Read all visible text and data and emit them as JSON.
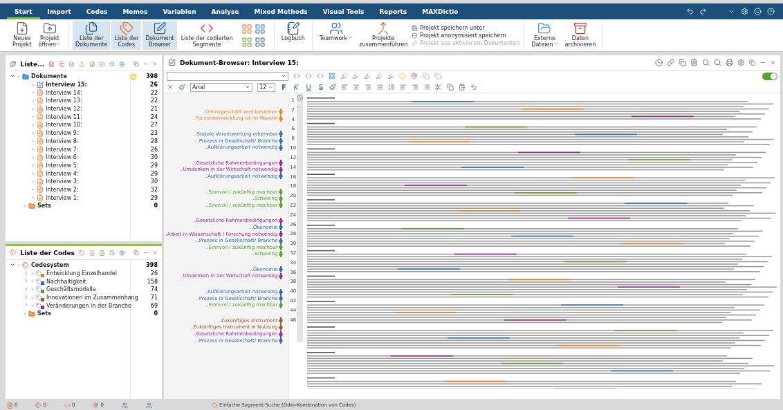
{
  "ribbon": {
    "tabs": [
      {
        "label": "Start",
        "selected": true
      },
      {
        "label": "Import",
        "selected": false
      },
      {
        "label": "Codes",
        "selected": false
      },
      {
        "label": "Memos",
        "selected": false
      },
      {
        "label": "Variablen",
        "selected": false
      },
      {
        "label": "Analyse",
        "selected": false
      },
      {
        "label": "Mixed Methods",
        "selected": false
      },
      {
        "label": "Visual Tools",
        "selected": false
      },
      {
        "label": "Reports",
        "selected": false
      },
      {
        "label": "MAXDictio",
        "selected": false
      }
    ],
    "groups": [
      [
        {
          "kind": "large",
          "label": "Neues\nProjekt",
          "selected": false,
          "dropdown": false
        },
        {
          "kind": "large",
          "label": "Projekt\nöffnen",
          "selected": false,
          "dropdown": true
        }
      ],
      [
        {
          "kind": "large",
          "label": "Liste der\nDokumente",
          "selected": true,
          "dropdown": false
        },
        {
          "kind": "large",
          "label": "Liste der\nCodes",
          "selected": true,
          "dropdown": false
        },
        {
          "kind": "large",
          "label": "Dokument\nBrowser",
          "selected": true,
          "dropdown": false
        },
        {
          "kind": "large",
          "label": "Liste der codierten\nSegmente",
          "selected": false,
          "dropdown": false
        },
        {
          "kind": "grid"
        }
      ],
      [
        {
          "kind": "large",
          "label": "Logbuch",
          "selected": false,
          "dropdown": false
        }
      ],
      [
        {
          "kind": "large",
          "label": "Teamwork",
          "selected": false,
          "dropdown": true
        },
        {
          "kind": "large",
          "label": "Projekte\nzusammenführen",
          "selected": false,
          "dropdown": false
        },
        {
          "kind": "stack",
          "items": [
            {
              "label": "Projekt speichern unter",
              "disabled": false
            },
            {
              "label": "Projekt anonymisiert speichern",
              "disabled": false
            },
            {
              "label": "Projekt aus aktivierten Dokumenten",
              "disabled": true
            }
          ]
        }
      ],
      [
        {
          "kind": "large",
          "label": "Externe\nDateien",
          "selected": false,
          "dropdown": true
        },
        {
          "kind": "large",
          "label": "Daten\narchivieren",
          "selected": false,
          "dropdown": false
        }
      ]
    ]
  },
  "documents_panel": {
    "title": "Liste...",
    "root": {
      "label": "Dokumente",
      "count": "398",
      "expanded": true,
      "children": [
        {
          "label": "Interview 15:",
          "count": "26",
          "opened": true
        },
        {
          "label": "Interview 14:",
          "count": "22",
          "opened": false
        },
        {
          "label": "Interview 13:",
          "count": "22",
          "opened": false
        },
        {
          "label": "Interview 12:",
          "count": "21",
          "opened": false
        },
        {
          "label": "Interview 11:",
          "count": "24",
          "opened": false
        },
        {
          "label": "Interview 10:",
          "count": "27",
          "opened": false
        },
        {
          "label": "Interview 9:",
          "count": "23",
          "opened": false
        },
        {
          "label": "Interview 8:",
          "count": "28",
          "opened": false
        },
        {
          "label": "Interview 7:",
          "count": "26",
          "opened": false
        },
        {
          "label": "Interview 6:",
          "count": "30",
          "opened": false
        },
        {
          "label": "Interview 5:",
          "count": "29",
          "opened": false
        },
        {
          "label": "Interview 4:",
          "count": "29",
          "opened": false
        },
        {
          "label": "Interview 3:",
          "count": "30",
          "opened": false
        },
        {
          "label": "Interview 2:",
          "count": "32",
          "opened": false
        },
        {
          "label": "Interview 1:",
          "count": "29",
          "opened": false
        }
      ]
    },
    "sets": {
      "label": "Sets",
      "count": "0"
    }
  },
  "codes_panel": {
    "title": "Liste der Codes",
    "root": {
      "label": "Codesystem",
      "count": "398",
      "expanded": true,
      "children": [
        {
          "label": "Entwicklung Einzelhandel",
          "count": "26",
          "color": "#f07f1e",
          "expanded": false
        },
        {
          "label": "Nachhaltigkeit",
          "count": "158",
          "color": "#2f6db5",
          "expanded": false
        },
        {
          "label": "Geschäftsmodelle",
          "count": "74",
          "color": "#5aa02c",
          "expanded": false
        },
        {
          "label": "Innovationen im Zusammenhang",
          "count": "71",
          "color": "#a0522d",
          "expanded": false
        },
        {
          "label": "Veränderungen in der Branche",
          "count": "69",
          "color": "#a020a0",
          "expanded": false
        }
      ]
    },
    "sets": {
      "label": "Sets",
      "count": "0"
    }
  },
  "browser": {
    "title": "Dokument-Browser: Interview 15:",
    "edit_mode": true,
    "font": "Arial",
    "size": "12",
    "format_letters": [
      "F",
      "K",
      "U",
      "S"
    ],
    "margin_groups": [
      {
        "codes": [
          {
            "label": "..Onlinegeschäft wird bestehen",
            "color": "#f07f1e"
          },
          {
            "label": "..Flächenentwicklung ist im Wandel",
            "color": "#f07f1e"
          }
        ]
      },
      {
        "codes": [
          {
            "label": "..Soziale Verantwortung erkennbar",
            "color": "#2f6db5"
          },
          {
            "label": "..Prozess in Gesellschaft/ Branche",
            "color": "#2f6db5"
          },
          {
            "label": "..Aufklärungsarbeit notwendig",
            "color": "#2f6db5"
          }
        ]
      },
      {
        "codes": [
          {
            "label": "..Gesetzliche Rahmenbedingungen",
            "color": "#a020a0"
          },
          {
            "label": "..Umdenken in der Wirtschaft notwendig",
            "color": "#a020a0"
          },
          {
            "label": "..Aufklärungsarbeit notwendig",
            "color": "#2f6db5"
          }
        ]
      },
      {
        "codes": [
          {
            "label": "..Sinnvoll / zukünftig machbar",
            "color": "#5aa02c"
          },
          {
            "label": "..Schwierig",
            "color": "#5aa02c"
          },
          {
            "label": "..Sinnvoll / zukünftig machbar",
            "color": "#5aa02c"
          }
        ]
      },
      {
        "codes": [
          {
            "label": "..Gesetzliche Rahmenbedingungen",
            "color": "#a020a0"
          },
          {
            "label": "..Ökonomie",
            "color": "#2f6db5"
          },
          {
            "label": "..Arbeit in Wissenschaft / Forschung notwendig",
            "color": "#a020a0"
          },
          {
            "label": "..Prozess in Gesellschaft/ Branche",
            "color": "#2f6db5"
          },
          {
            "label": "..Sinnvoll / zukünftig machbar",
            "color": "#5aa02c"
          },
          {
            "label": "..Schwierig",
            "color": "#5aa02c"
          }
        ]
      },
      {
        "codes": [
          {
            "label": "..Ökonomie",
            "color": "#2f6db5"
          },
          {
            "label": "..Umdenken in der Wirtschaft notwendig",
            "color": "#a020a0"
          }
        ]
      },
      {
        "codes": [
          {
            "label": "..Aufklärungsarbeit notwendig",
            "color": "#2f6db5"
          },
          {
            "label": "..Prozess in Gesellschaft/ Branche",
            "color": "#2f6db5"
          },
          {
            "label": "..Sinnvoll / zukünftig machbar",
            "color": "#5aa02c"
          }
        ]
      },
      {
        "codes": [
          {
            "label": "..Zukünftiges Instrument",
            "color": "#a0522d"
          },
          {
            "label": "..Zukünftiges Instrument in Nutzung",
            "color": "#a0522d"
          },
          {
            "label": "..Gesetzliche Rahmenbedingungen",
            "color": "#a020a0"
          },
          {
            "label": "..Prozess in Gesellschaft/ Branche",
            "color": "#2f6db5"
          }
        ]
      }
    ],
    "paragraph_numbers": [
      "1",
      "2",
      "4",
      "6",
      "8",
      "10",
      "12",
      "14",
      "16",
      "18",
      "20",
      "22",
      "24",
      "26",
      "28",
      "30",
      "32",
      "34",
      "36",
      "38",
      "40",
      "42",
      "44",
      "46"
    ]
  },
  "status_bar": {
    "counts": [
      "0",
      "0",
      "0",
      "0"
    ],
    "search": "Einfache Segment-Suche (Oder-Kombination von Codes)"
  }
}
